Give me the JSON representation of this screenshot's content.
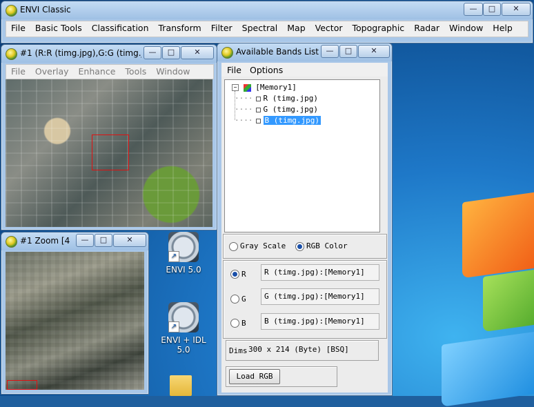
{
  "main_window": {
    "title": "ENVI Classic",
    "menu": [
      "File",
      "Basic Tools",
      "Classification",
      "Transform",
      "Filter",
      "Spectral",
      "Map",
      "Vector",
      "Topographic",
      "Radar",
      "Window",
      "Help"
    ],
    "controls": {
      "minimize": "—",
      "maximize": "□",
      "close": "✕"
    }
  },
  "image_window": {
    "title": "#1 (R:R (timg.jpg),G:G (timg.jpg",
    "menu": [
      "File",
      "Overlay",
      "Enhance",
      "Tools",
      "Window"
    ]
  },
  "zoom_window": {
    "title": "#1 Zoom [4"
  },
  "bands_window": {
    "title": "Available Bands List",
    "menu": [
      "File",
      "Options"
    ],
    "tree": {
      "root": "[Memory1]",
      "bands": [
        "R (timg.jpg)",
        "G (timg.jpg)",
        "B (timg.jpg)"
      ],
      "selected_index": 2
    },
    "mode": {
      "gray": "Gray Scale",
      "rgb": "RGB Color",
      "selected": "rgb"
    },
    "channels": [
      {
        "label": "R",
        "value": "R (timg.jpg):[Memory1]",
        "checked": true
      },
      {
        "label": "G",
        "value": "G (timg.jpg):[Memory1]",
        "checked": false
      },
      {
        "label": "B",
        "value": "B (timg.jpg):[Memory1]",
        "checked": false
      }
    ],
    "dims_label": "Dims",
    "dims_value": "300 x 214 (Byte) [BSQ]",
    "load_button": "Load RGB"
  },
  "desktop_icons": [
    {
      "label": "ENVI 5.0"
    },
    {
      "label": "ENVI + IDL 5.0"
    }
  ],
  "colors": {
    "selection": "#3399ff",
    "window_frame": "#a9c7e8",
    "zoom_box": "#e01010"
  }
}
